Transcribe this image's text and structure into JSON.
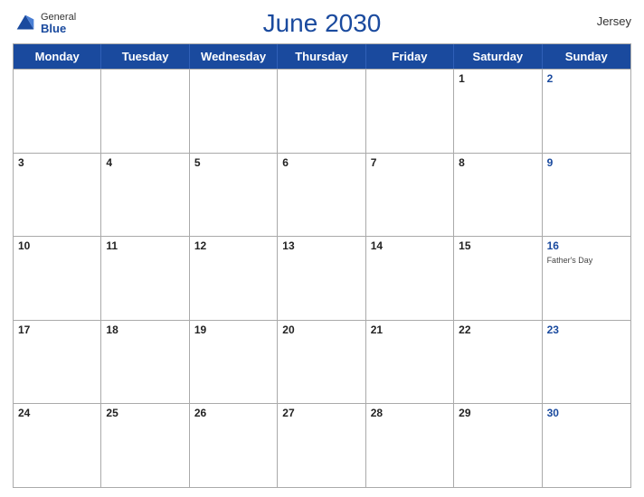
{
  "header": {
    "title": "June 2030",
    "region": "Jersey",
    "logo_general": "General",
    "logo_blue": "Blue"
  },
  "days_of_week": [
    "Monday",
    "Tuesday",
    "Wednesday",
    "Thursday",
    "Friday",
    "Saturday",
    "Sunday"
  ],
  "weeks": [
    [
      {
        "num": "",
        "event": ""
      },
      {
        "num": "",
        "event": ""
      },
      {
        "num": "",
        "event": ""
      },
      {
        "num": "",
        "event": ""
      },
      {
        "num": "",
        "event": ""
      },
      {
        "num": "1",
        "event": ""
      },
      {
        "num": "2",
        "event": "",
        "sunday": true
      }
    ],
    [
      {
        "num": "3",
        "event": ""
      },
      {
        "num": "4",
        "event": ""
      },
      {
        "num": "5",
        "event": ""
      },
      {
        "num": "6",
        "event": ""
      },
      {
        "num": "7",
        "event": ""
      },
      {
        "num": "8",
        "event": ""
      },
      {
        "num": "9",
        "event": "",
        "sunday": true
      }
    ],
    [
      {
        "num": "10",
        "event": ""
      },
      {
        "num": "11",
        "event": ""
      },
      {
        "num": "12",
        "event": ""
      },
      {
        "num": "13",
        "event": ""
      },
      {
        "num": "14",
        "event": ""
      },
      {
        "num": "15",
        "event": ""
      },
      {
        "num": "16",
        "event": "Father's Day",
        "sunday": true
      }
    ],
    [
      {
        "num": "17",
        "event": ""
      },
      {
        "num": "18",
        "event": ""
      },
      {
        "num": "19",
        "event": ""
      },
      {
        "num": "20",
        "event": ""
      },
      {
        "num": "21",
        "event": ""
      },
      {
        "num": "22",
        "event": ""
      },
      {
        "num": "23",
        "event": "",
        "sunday": true
      }
    ],
    [
      {
        "num": "24",
        "event": ""
      },
      {
        "num": "25",
        "event": ""
      },
      {
        "num": "26",
        "event": ""
      },
      {
        "num": "27",
        "event": ""
      },
      {
        "num": "28",
        "event": ""
      },
      {
        "num": "29",
        "event": ""
      },
      {
        "num": "30",
        "event": "",
        "sunday": true
      }
    ]
  ]
}
